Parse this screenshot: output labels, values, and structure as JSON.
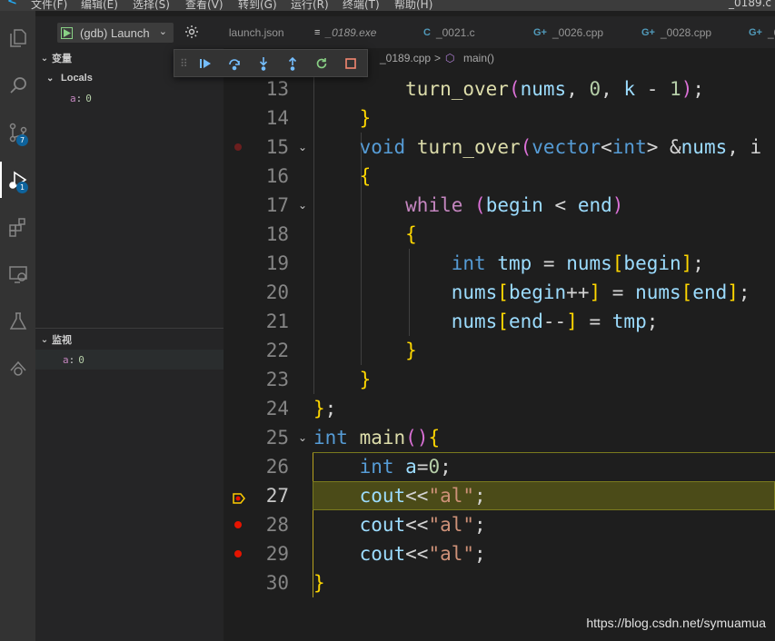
{
  "menubar": {
    "items": [
      "文件(F)",
      "编辑(E)",
      "选择(S)",
      "查看(V)",
      "转到(G)",
      "运行(R)",
      "终端(T)",
      "帮助(H)"
    ],
    "window_title": "_0189.c"
  },
  "activity": {
    "icons": [
      "explorer-icon",
      "search-icon",
      "source-control-icon",
      "run-debug-icon",
      "extensions-icon",
      "remote-explorer-icon",
      "testing-icon",
      "git-graph-icon"
    ],
    "scm_badge": "7",
    "debug_badge": "1"
  },
  "sidebar": {
    "launch_config": "(gdb) Launch",
    "variables_title": "变量",
    "locals_label": "Locals",
    "locals": [
      {
        "name": "a",
        "value": "0"
      }
    ],
    "watch_title": "监视",
    "watch": [
      {
        "name": "a",
        "value": "0"
      }
    ]
  },
  "tabs": [
    {
      "icon": "settings-json-icon",
      "label": "launch.json",
      "italic": false
    },
    {
      "icon": "exe-icon",
      "label": "_0189.exe",
      "italic": true
    },
    {
      "icon": "c-icon",
      "label": "_0021.c",
      "italic": false
    },
    {
      "icon": "cpp-icon",
      "label": "_0026.cpp",
      "italic": false
    },
    {
      "icon": "cpp-icon",
      "label": "_0028.cpp",
      "italic": false
    },
    {
      "icon": "cpp-icon",
      "label": "_0",
      "italic": false
    }
  ],
  "breadcrumb": {
    "file": "_0189.cpp",
    "separator": ">",
    "symbol": "main()"
  },
  "debug_toolbar": [
    "continue-button",
    "step-over-button",
    "step-into-button",
    "step-out-button",
    "restart-button",
    "stop-button"
  ],
  "code_lines": [
    {
      "n": "13",
      "text": "        turn_over(nums, 0, k - 1);"
    },
    {
      "n": "14",
      "text": "    }"
    },
    {
      "n": "15",
      "text": "    void turn_over(vector<int> &nums, i"
    },
    {
      "n": "16",
      "text": "    {"
    },
    {
      "n": "17",
      "text": "        while (begin < end)"
    },
    {
      "n": "18",
      "text": "        {"
    },
    {
      "n": "19",
      "text": "            int tmp = nums[begin];"
    },
    {
      "n": "20",
      "text": "            nums[begin++] = nums[end];"
    },
    {
      "n": "21",
      "text": "            nums[end--] = tmp;"
    },
    {
      "n": "22",
      "text": "        }"
    },
    {
      "n": "23",
      "text": "    }"
    },
    {
      "n": "24",
      "text": "};"
    },
    {
      "n": "25",
      "text": "int main(){"
    },
    {
      "n": "26",
      "text": "    int a=0;"
    },
    {
      "n": "27",
      "text": "    cout<<\"al\";"
    },
    {
      "n": "28",
      "text": "    cout<<\"al\";"
    },
    {
      "n": "29",
      "text": "    cout<<\"al\";"
    },
    {
      "n": "30",
      "text": "}"
    }
  ],
  "breakpoints": {
    "15": "disabled",
    "27": "current",
    "28": "active",
    "29": "active"
  },
  "current_line": "27",
  "watermark": "https://blog.csdn.net/symuamua",
  "colors": {
    "keyword_control": "#c586c0",
    "type": "#569cd6",
    "function": "#dcdcaa",
    "variable": "#9cdcfe",
    "number": "#b5cea8",
    "string": "#ce9178",
    "breakpoint": "#e51400",
    "current_line_bg": "#4b4b18"
  }
}
